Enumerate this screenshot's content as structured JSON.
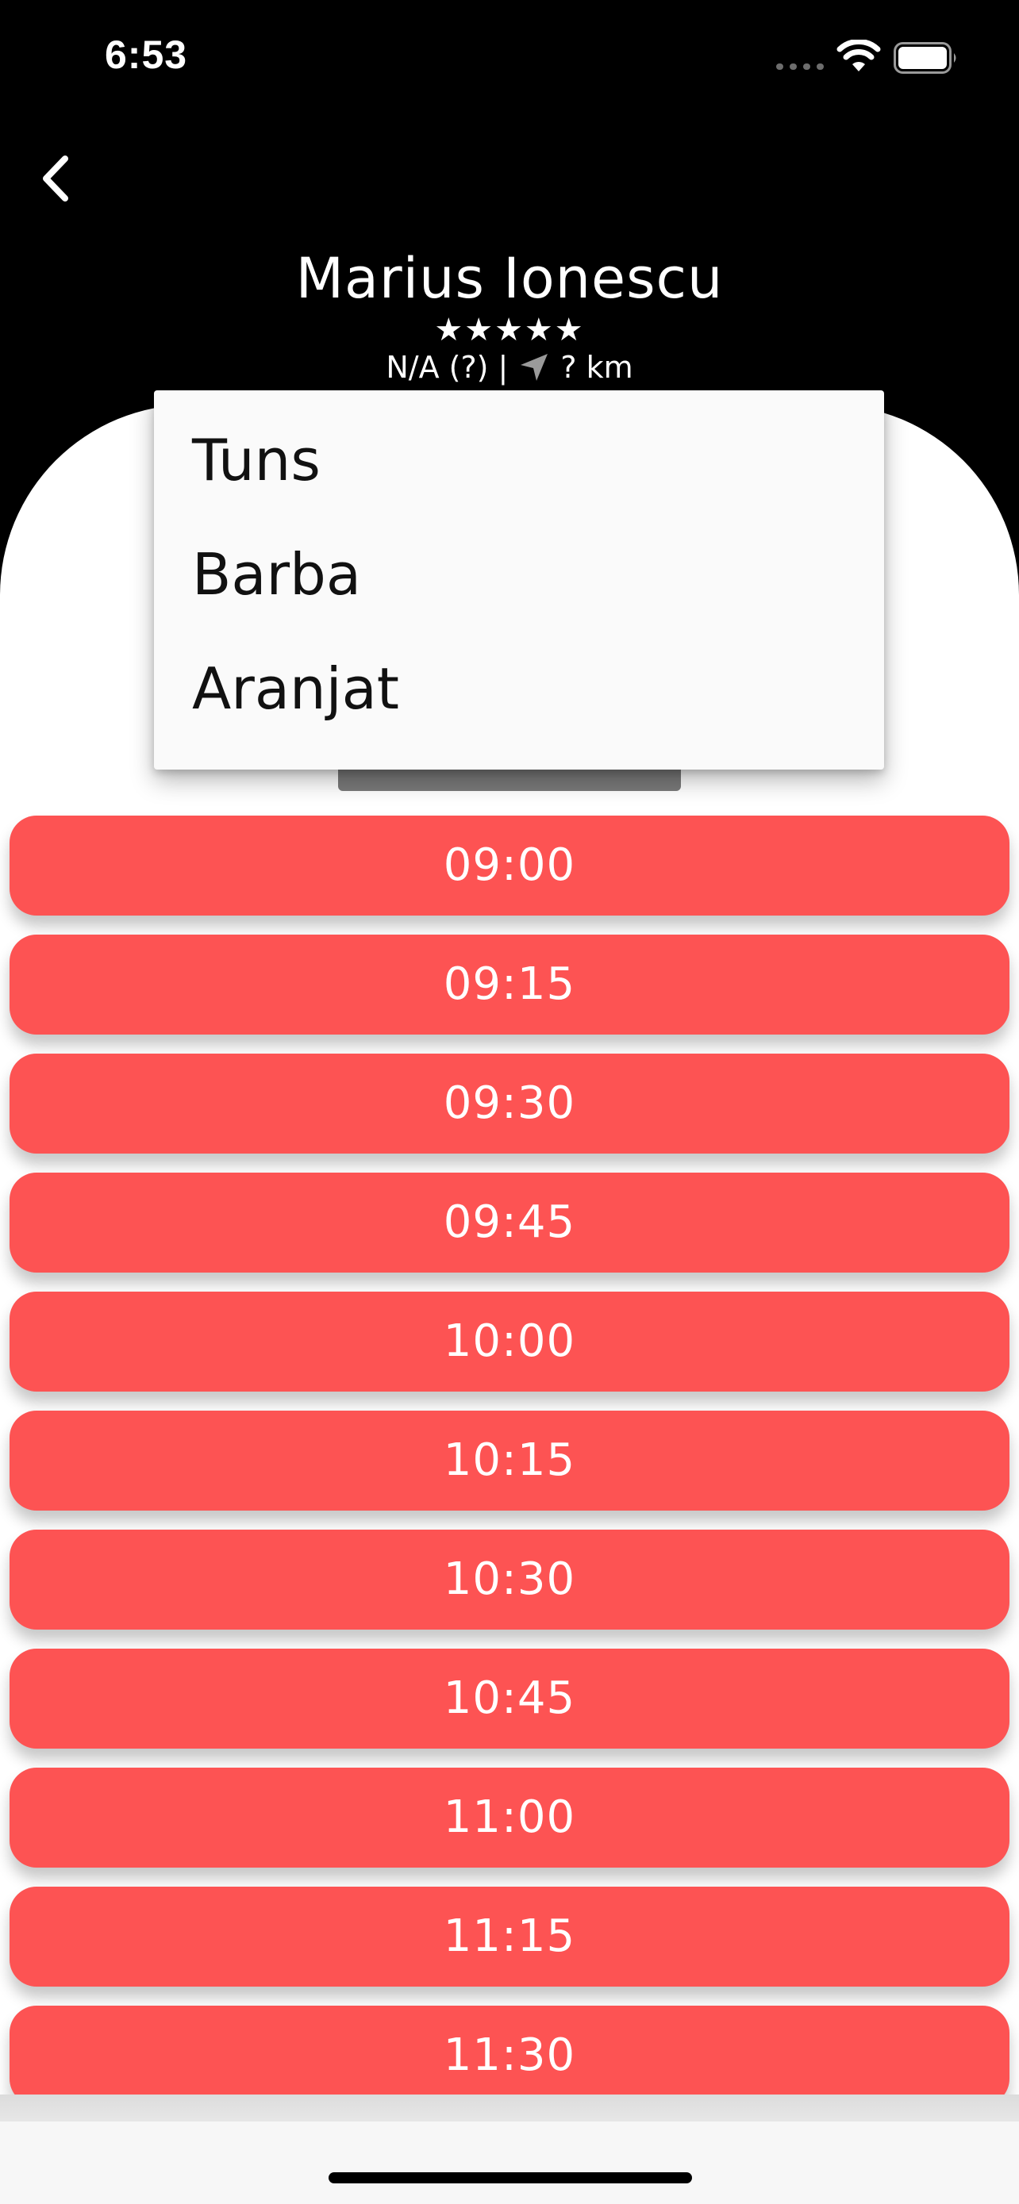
{
  "status_bar": {
    "time": "6:53"
  },
  "header": {
    "name": "Marius Ionescu",
    "stars": "★★★★★",
    "rating_text": "N/A (?) |",
    "distance_text": "? km"
  },
  "dropdown": {
    "items": [
      "Tuns",
      "Barba",
      "Aranjat"
    ]
  },
  "time_slots": [
    "09:00",
    "09:15",
    "09:30",
    "09:45",
    "10:00",
    "10:15",
    "10:30",
    "10:45",
    "11:00",
    "11:15",
    "11:30"
  ],
  "colors": {
    "slot_background": "#fd5353",
    "header_background": "#000000",
    "panel_background": "#ffffff",
    "dropdown_background": "#fafafa"
  },
  "icons": {
    "back": "chevron-left-icon",
    "location": "navigation-arrow-icon",
    "wifi": "wifi-icon",
    "battery": "battery-icon",
    "signal": "signal-dots-icon"
  }
}
